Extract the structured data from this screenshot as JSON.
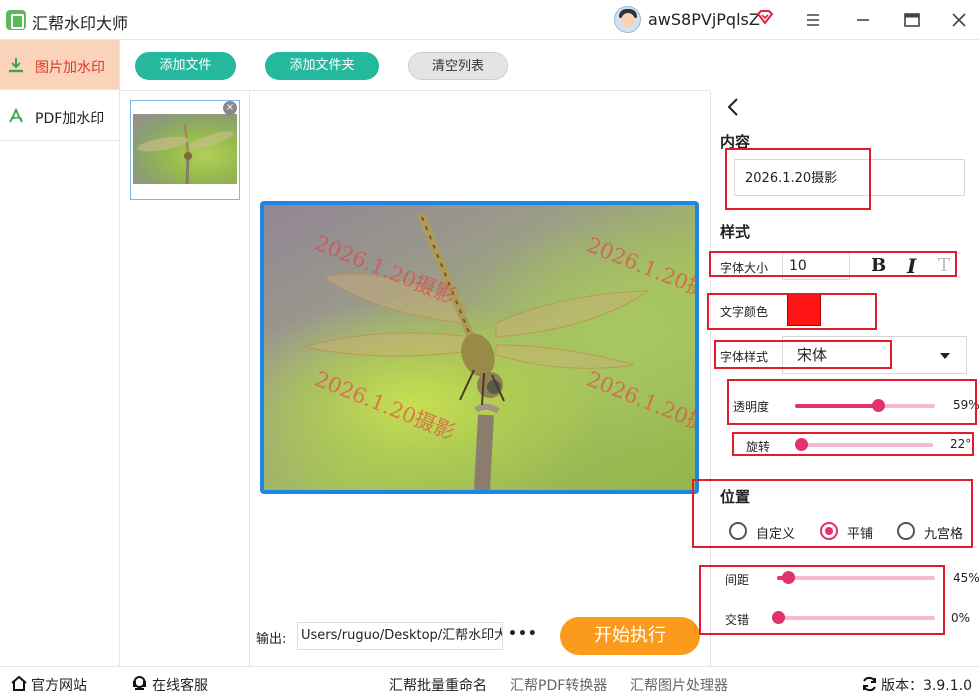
{
  "app": {
    "title": "汇帮水印大师",
    "username": "awS8PVjPqlsZ"
  },
  "sidebar": {
    "items": [
      {
        "label": "图片加水印",
        "active": true
      },
      {
        "label": "PDF加水印",
        "active": false
      }
    ]
  },
  "toolbar": {
    "add_file": "添加文件",
    "add_folder": "添加文件夹",
    "clear_list": "清空列表"
  },
  "preview": {
    "watermark_text": "2026.1.20摄影"
  },
  "output": {
    "label": "输出:",
    "path": "Users/ruguo/Desktop/汇帮水印大师",
    "more": "•••",
    "start": "开始执行"
  },
  "panel": {
    "content_title": "内容",
    "content_value": "2026.1.20摄影",
    "style_title": "样式",
    "font_size_label": "字体大小",
    "font_size_value": "10",
    "bold": "B",
    "italic": "I",
    "strike": "T",
    "text_color_label": "文字颜色",
    "text_color": "#ff1414",
    "font_style_label": "字体样式",
    "font_style_value": "宋体",
    "opacity_label": "透明度",
    "opacity_value": "59%",
    "opacity_fraction": 0.59,
    "rotation_label": "旋转",
    "rotation_value": "22°",
    "rotation_fraction": 0.03,
    "position_title": "位置",
    "position_options": [
      "自定义",
      "平铺",
      "九宫格"
    ],
    "position_selected": 1,
    "spacing_label": "间距",
    "spacing_value": "45%",
    "spacing_fraction": 0.07,
    "offset_label": "交错",
    "offset_value": "0%",
    "offset_fraction": 0.0
  },
  "statusbar": {
    "website": "官方网站",
    "support": "在线客服",
    "links": [
      "汇帮批量重命名",
      "汇帮PDF转换器",
      "汇帮图片处理器"
    ],
    "version": "版本：3.9.1.0"
  },
  "colors": {
    "accent_green": "#24b89c",
    "start_orange": "#fb9a1b",
    "slider_pink": "#e23269",
    "highlight_red": "#e01e2a",
    "active_tab_bg": "#fbd3ba"
  }
}
